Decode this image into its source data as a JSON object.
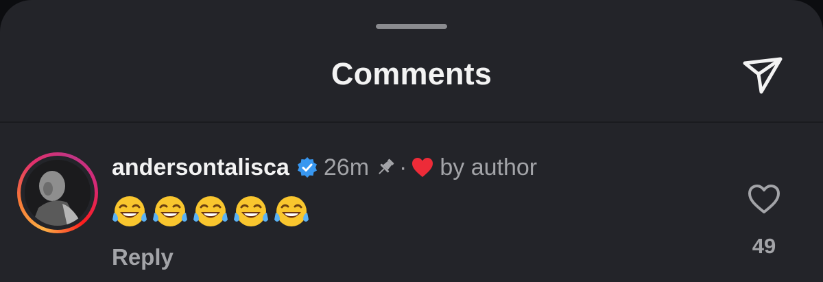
{
  "header": {
    "title": "Comments",
    "send_icon": "paper-plane-icon"
  },
  "comment": {
    "username": "andersontalisca",
    "verified": true,
    "time": "26m",
    "pinned_icon": "pin-icon",
    "separator": "·",
    "author_like_icon": "red-heart-icon",
    "author_like_label": "by author",
    "text_emojis": [
      "😂",
      "😂",
      "😂",
      "😂",
      "😂"
    ],
    "reply_label": "Reply",
    "like_icon": "heart-outline-icon",
    "like_count": "49"
  },
  "colors": {
    "background": "#232429",
    "primary_text": "#f3f3f3",
    "secondary_text": "#a3a4a8",
    "verified_blue": "#3897f0",
    "heart_red": "#ed2b38"
  }
}
